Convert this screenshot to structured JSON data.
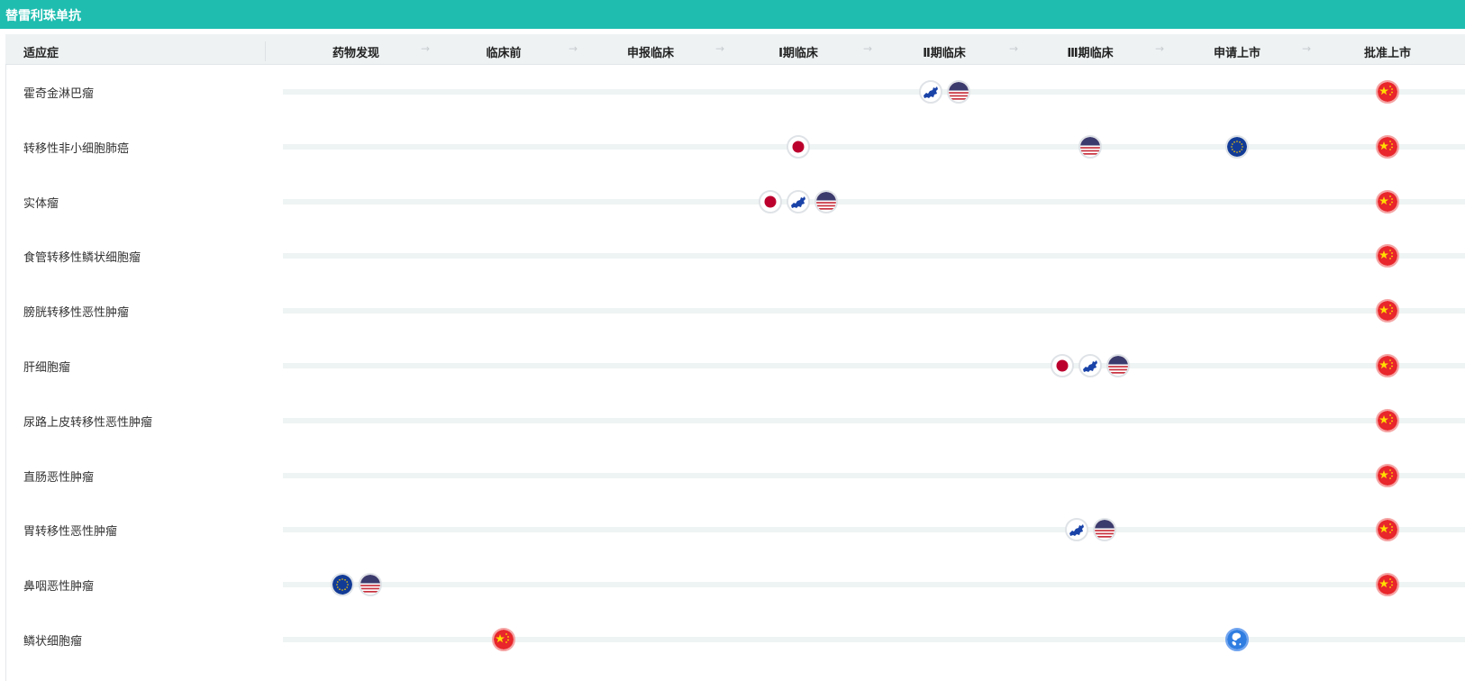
{
  "title": "替雷利珠单抗",
  "header": {
    "indication": "适应症",
    "stages": [
      "药物发现",
      "临床前",
      "申报临床",
      "Ⅰ期临床",
      "Ⅱ期临床",
      "Ⅲ期临床",
      "申请上市",
      "批准上市"
    ]
  },
  "rows": [
    {
      "label": "霍奇金淋巴瘤",
      "markers": [
        {
          "stage": 4,
          "icons": [
            "europe-map",
            "us"
          ]
        },
        {
          "stage": 7,
          "icons": [
            "cn"
          ]
        }
      ]
    },
    {
      "label": "转移性非小细胞肺癌",
      "markers": [
        {
          "stage": 3,
          "icons": [
            "jp"
          ]
        },
        {
          "stage": 5,
          "icons": [
            "us"
          ]
        },
        {
          "stage": 6,
          "icons": [
            "eu"
          ]
        },
        {
          "stage": 7,
          "icons": [
            "cn"
          ]
        }
      ]
    },
    {
      "label": "实体瘤",
      "markers": [
        {
          "stage": 3,
          "icons": [
            "jp",
            "europe-map",
            "us"
          ]
        },
        {
          "stage": 7,
          "icons": [
            "cn"
          ]
        }
      ]
    },
    {
      "label": "食管转移性鳞状细胞瘤",
      "markers": [
        {
          "stage": 7,
          "icons": [
            "cn"
          ]
        }
      ]
    },
    {
      "label": "膀胱转移性恶性肿瘤",
      "markers": [
        {
          "stage": 7,
          "icons": [
            "cn"
          ]
        }
      ]
    },
    {
      "label": "肝细胞瘤",
      "markers": [
        {
          "stage": 5,
          "icons": [
            "jp",
            "europe-map",
            "us"
          ]
        },
        {
          "stage": 7,
          "icons": [
            "cn"
          ]
        }
      ]
    },
    {
      "label": "尿路上皮转移性恶性肿瘤",
      "markers": [
        {
          "stage": 7,
          "icons": [
            "cn"
          ]
        }
      ]
    },
    {
      "label": "直肠恶性肿瘤",
      "markers": [
        {
          "stage": 7,
          "icons": [
            "cn"
          ]
        }
      ]
    },
    {
      "label": "胃转移性恶性肿瘤",
      "markers": [
        {
          "stage": 5,
          "icons": [
            "europe-map",
            "us"
          ]
        },
        {
          "stage": 7,
          "icons": [
            "cn"
          ]
        }
      ]
    },
    {
      "label": "鼻咽恶性肿瘤",
      "markers": [
        {
          "stage": 0,
          "icons": [
            "eu",
            "us"
          ]
        },
        {
          "stage": 7,
          "icons": [
            "cn"
          ]
        }
      ]
    },
    {
      "label": "鳞状细胞瘤",
      "markers": [
        {
          "stage": 1,
          "icons": [
            "cn"
          ]
        },
        {
          "stage": 6,
          "icons": [
            "global"
          ]
        }
      ]
    }
  ]
}
